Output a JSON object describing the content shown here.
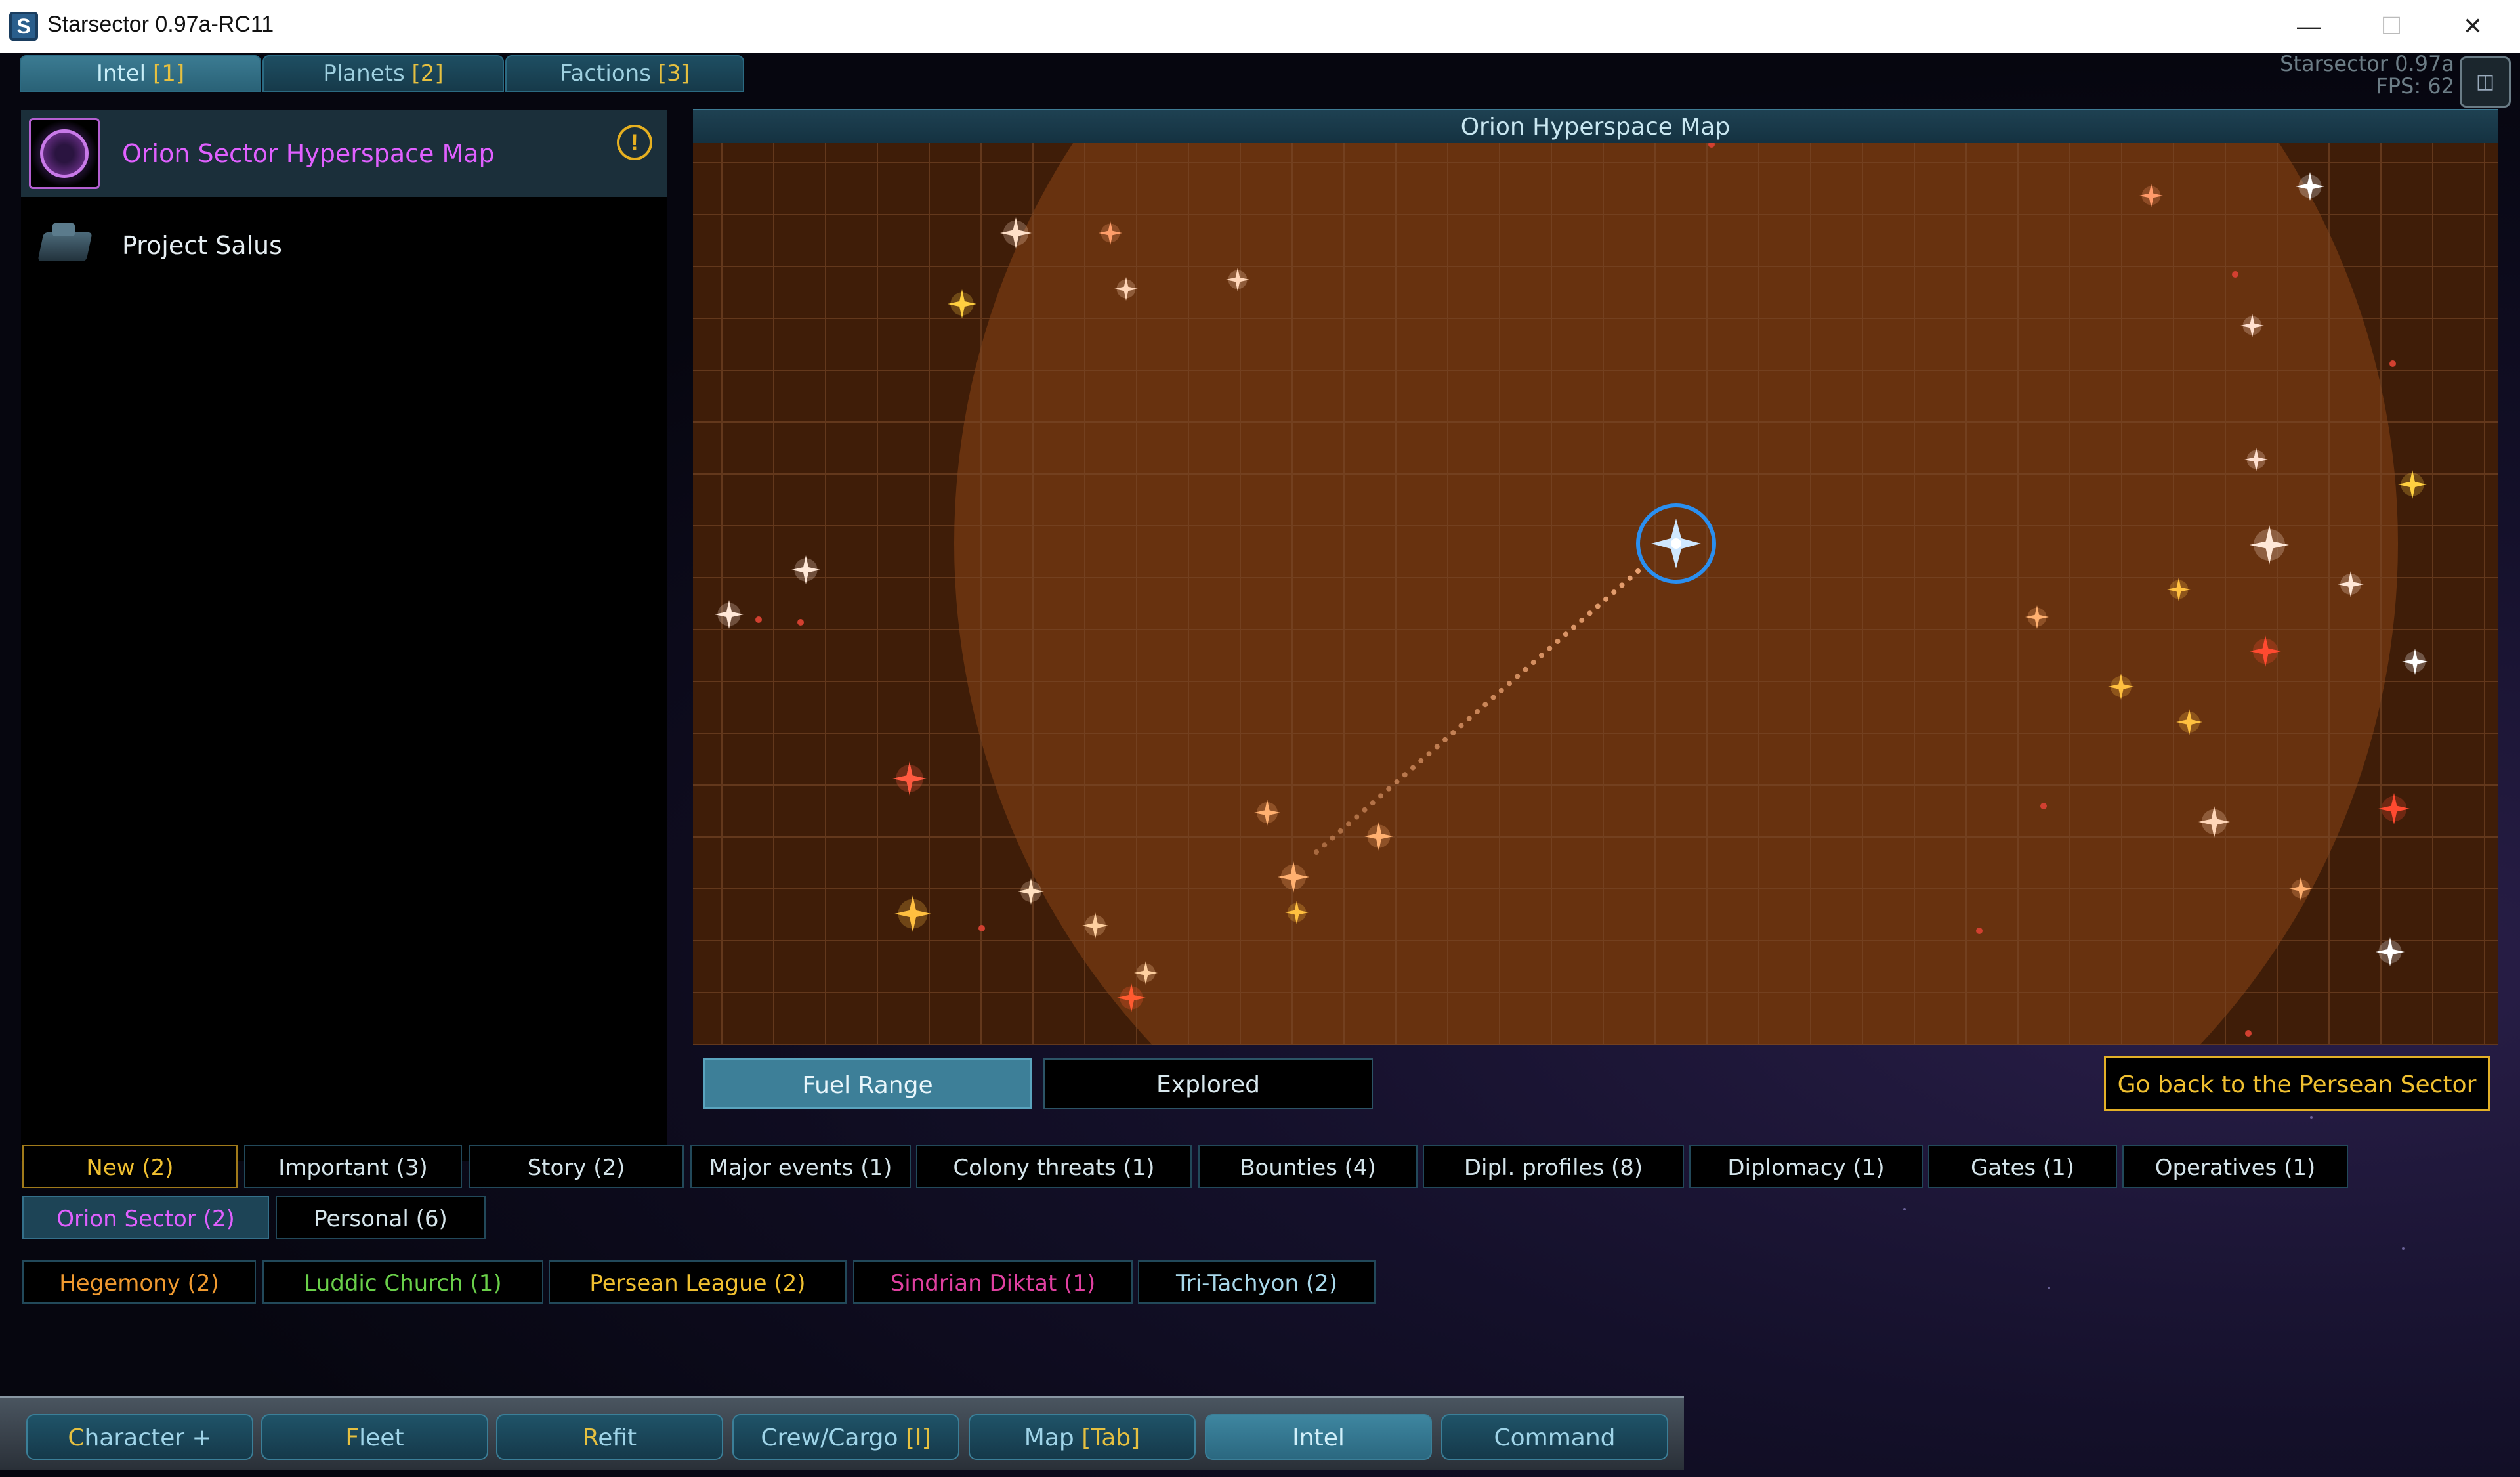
{
  "window": {
    "title": "Starsector 0.97a-RC11",
    "app_icon": "S",
    "minimize": "—",
    "maximize": "☐",
    "close": "✕"
  },
  "top_tabs": [
    {
      "label": "Intel ",
      "count": "[1]"
    },
    {
      "label": "Planets ",
      "count": "[2]"
    },
    {
      "label": "Factions ",
      "count": "[3]"
    }
  ],
  "fps_overlay": {
    "line1": "Starsector 0.97a",
    "line2": "FPS:  62"
  },
  "intel_items": [
    {
      "label": "Orion Sector Hyperspace Map",
      "color": "#e060ff"
    },
    {
      "label": "Project Salus",
      "color": "#e6eef2"
    }
  ],
  "map": {
    "title": "Orion Hyperspace Map",
    "colors": {
      "background": "#3f1d08",
      "fuel_range": "#6a3410",
      "grid": "#7b4a2a",
      "marker": "#2a8ff0"
    }
  },
  "map_buttons": {
    "fuel_range": "Fuel Range",
    "explored": "Explored",
    "go_back": "Go back to the Persean Sector"
  },
  "filter_tags": [
    {
      "label": "New (2)",
      "color": "#f0c030"
    },
    {
      "label": "Important (3)",
      "color": "#d4e4ea"
    },
    {
      "label": "Story (2)",
      "color": "#d4e4ea"
    },
    {
      "label": "Major events (1)",
      "color": "#d4e4ea"
    },
    {
      "label": "Colony threats (1)",
      "color": "#d4e4ea"
    },
    {
      "label": "Bounties (4)",
      "color": "#d4e4ea"
    },
    {
      "label": "Dipl. profiles (8)",
      "color": "#d4e4ea"
    },
    {
      "label": "Diplomacy (1)",
      "color": "#d4e4ea"
    },
    {
      "label": "Gates (1)",
      "color": "#d4e4ea"
    },
    {
      "label": "Operatives (1)",
      "color": "#d4e4ea"
    },
    {
      "label": "Orion Sector (2)",
      "color": "#e060ff"
    },
    {
      "label": "Personal (6)",
      "color": "#d4e4ea"
    }
  ],
  "faction_tags": [
    {
      "label": "Hegemony (2)",
      "color": "#f09a30"
    },
    {
      "label": "Luddic Church (1)",
      "color": "#6ad04a"
    },
    {
      "label": "Persean League (2)",
      "color": "#f0c030"
    },
    {
      "label": "Sindrian Diktat (1)",
      "color": "#e040a0"
    },
    {
      "label": "Tri-Tachyon (2)",
      "color": "#a8d8ea"
    }
  ],
  "bottom_tabs": [
    {
      "hotkey": "C",
      "rest": "haracter",
      "suffix": " +"
    },
    {
      "hotkey": "F",
      "rest": "leet",
      "suffix": ""
    },
    {
      "hotkey": "R",
      "rest": "efit",
      "suffix": ""
    },
    {
      "hotkey": "",
      "rest": "Crew/Cargo ",
      "suffix": "[I]"
    },
    {
      "hotkey": "",
      "rest": "Map ",
      "suffix": "[Tab]"
    },
    {
      "hotkey": "",
      "rest": "Intel",
      "suffix": ""
    },
    {
      "hotkey": "",
      "rest": "Command",
      "suffix": ""
    }
  ]
}
